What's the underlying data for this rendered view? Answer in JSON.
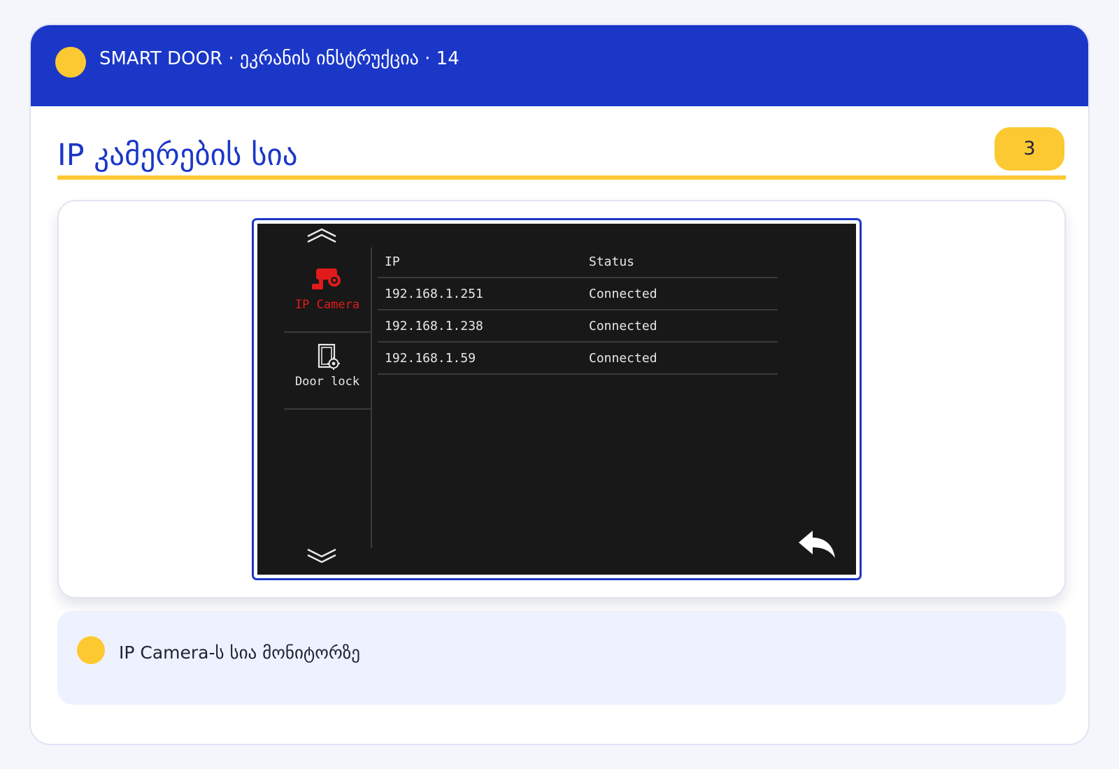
{
  "header": {
    "title": "SMART DOOR · ეკრანის ინსტრუქცია · 14"
  },
  "section": {
    "title": "IP კამერების სია",
    "page_number": "3"
  },
  "device_screen": {
    "sidebar": {
      "items": [
        {
          "label": "IP Camera",
          "icon": "cctv-camera-icon",
          "active": true,
          "color": "#e11b1b"
        },
        {
          "label": "Door lock",
          "icon": "door-lock-settings-icon",
          "active": false
        }
      ],
      "scroll_up_icon": "double-chevron-up-icon",
      "scroll_down_icon": "double-chevron-down-icon"
    },
    "table": {
      "columns": [
        "IP",
        "Status"
      ],
      "rows": [
        {
          "ip": "192.168.1.251",
          "status": "Connected"
        },
        {
          "ip": "192.168.1.238",
          "status": "Connected"
        },
        {
          "ip": "192.168.1.59",
          "status": "Connected"
        }
      ]
    },
    "back_icon": "return-arrow-icon"
  },
  "caption": {
    "text": "IP Camera-ს სია მონიტორზე"
  },
  "colors": {
    "brand_blue": "#1b37c8",
    "accent_yellow": "#fdc932",
    "screen_background": "#181818",
    "active_red": "#e11b1b"
  }
}
